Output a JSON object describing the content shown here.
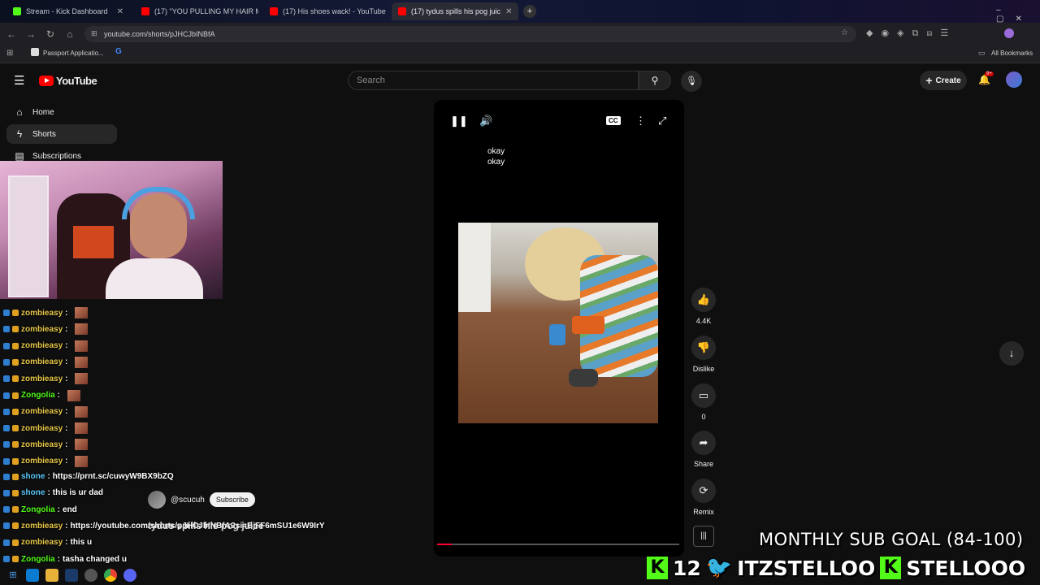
{
  "browser": {
    "tabs": [
      {
        "title": "Stream - Kick Dashboard",
        "color": "#53fc18"
      },
      {
        "title": "(17) \"YOU PULLING MY HAIR M",
        "color": "#ff0000"
      },
      {
        "title": "(17) His shoes wack! - YouTube",
        "color": "#ff0000"
      },
      {
        "title": "(17) tydus spills his pog juic",
        "color": "#ff0000"
      }
    ],
    "url": "youtube.com/shorts/pJHCJbINBfA",
    "bookmarks": [
      "Passport Applicatio...",
      "All Bookmarks"
    ]
  },
  "youtube": {
    "logo": "YouTube",
    "search_placeholder": "Search",
    "create_label": "Create",
    "notif_badge": "9+"
  },
  "sidebar": {
    "items": [
      {
        "label": "Home",
        "icon": "home-icon"
      },
      {
        "label": "Shorts",
        "icon": "shorts-icon"
      },
      {
        "label": "Subscriptions",
        "icon": "subscriptions-icon"
      }
    ]
  },
  "chat": [
    {
      "user": "zombieasy",
      "msg": "",
      "color": "#e8c84a"
    },
    {
      "user": "zombieasy",
      "msg": "",
      "color": "#e8c84a"
    },
    {
      "user": "zombieasy",
      "msg": "",
      "color": "#e8c84a"
    },
    {
      "user": "zombieasy",
      "msg": "",
      "color": "#e8c84a"
    },
    {
      "user": "zombieasy",
      "msg": "",
      "color": "#e8c84a"
    },
    {
      "user": "Zongolia",
      "msg": "",
      "color": "#53fc18"
    },
    {
      "user": "zombieasy",
      "msg": "",
      "color": "#e8c84a"
    },
    {
      "user": "zombieasy",
      "msg": "",
      "color": "#e8c84a"
    },
    {
      "user": "zombieasy",
      "msg": "",
      "color": "#e8c84a"
    },
    {
      "user": "zombieasy",
      "msg": "",
      "color": "#e8c84a"
    },
    {
      "user": "shone",
      "msg": "https://prnt.sc/cuwyW9BX9bZQ",
      "color": "#5ac8fa"
    },
    {
      "user": "shone",
      "msg": "this is ur dad",
      "color": "#5ac8fa"
    },
    {
      "user": "Zongolia",
      "msg": "end",
      "color": "#53fc18"
    },
    {
      "user": "zombieasy",
      "msg": "https://youtube.com/shorts/pJHCJbINBfA?si=BjFF6mSU1e6W9IrY",
      "color": "#e8c84a"
    },
    {
      "user": "zombieasy",
      "msg": "this u",
      "color": "#e8c84a"
    },
    {
      "user": "Zongolia",
      "msg": "tasha changed u",
      "color": "#53fc18"
    }
  ],
  "player": {
    "subtitle_1": "okay",
    "subtitle_2": "okay",
    "progress": 0.06
  },
  "actions": {
    "like_count": "4.4K",
    "dislike_label": "Dislike",
    "comment_count": "0",
    "share_label": "Share",
    "remix_label": "Remix"
  },
  "short": {
    "channel": "@scucuh",
    "subscribe_label": "Subscribe",
    "title": "tydus spills his pog juice"
  },
  "overlay": {
    "sub_goal": "MONTHLY SUB GOAL (84-100)",
    "sub_count": "12",
    "twitter": "ITZSTELLOO",
    "kick": "STELLOOO"
  }
}
